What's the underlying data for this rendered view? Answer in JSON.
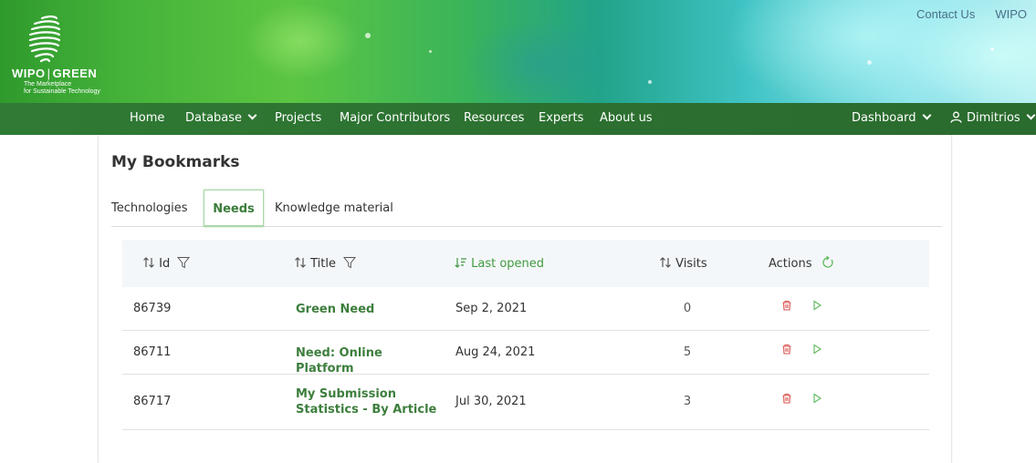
{
  "brand": {
    "name_left": "WIPO",
    "name_right": "GREEN",
    "tagline_1": "The Marketplace",
    "tagline_2": "for Sustainable Technology"
  },
  "top_links": {
    "contact": "Contact Us",
    "wipo": "WIPO"
  },
  "nav": {
    "home": "Home",
    "database": "Database",
    "projects": "Projects",
    "major_contributors": "Major Contributors",
    "resources": "Resources",
    "experts": "Experts",
    "about": "About us",
    "dashboard": "Dashboard",
    "user": "Dimitrios"
  },
  "page": {
    "title": "My Bookmarks"
  },
  "tabs": [
    {
      "label": "Technologies",
      "active": false
    },
    {
      "label": "Needs",
      "active": true
    },
    {
      "label": "Knowledge material",
      "active": false
    }
  ],
  "table": {
    "columns": {
      "id": "Id",
      "title": "Title",
      "last_opened": "Last opened",
      "visits": "Visits",
      "actions": "Actions"
    },
    "rows": [
      {
        "id": "86739",
        "title": "Green Need",
        "last_opened": "Sep 2, 2021",
        "visits": "0"
      },
      {
        "id": "86711",
        "title": "Need: Online Platform",
        "last_opened": "Aug 24, 2021",
        "visits": "5"
      },
      {
        "id": "86717",
        "title": "My Submission Statistics - By Article",
        "last_opened": "Jul 30, 2021",
        "visits": "3"
      }
    ]
  },
  "colors": {
    "nav_green": "#2c6f30",
    "accent_green": "#3d7e3d",
    "delete_red": "#d9534f",
    "open_green": "#5cb85c",
    "link_blue": "#4a6f88"
  },
  "icons": {
    "sort": "sort-arrows-icon",
    "filter": "filter-icon",
    "sorted_desc": "sort-desc-icon",
    "refresh": "refresh-icon",
    "delete": "trash-icon",
    "open": "play-icon",
    "user": "user-icon",
    "caret": "chevron-down-icon"
  }
}
